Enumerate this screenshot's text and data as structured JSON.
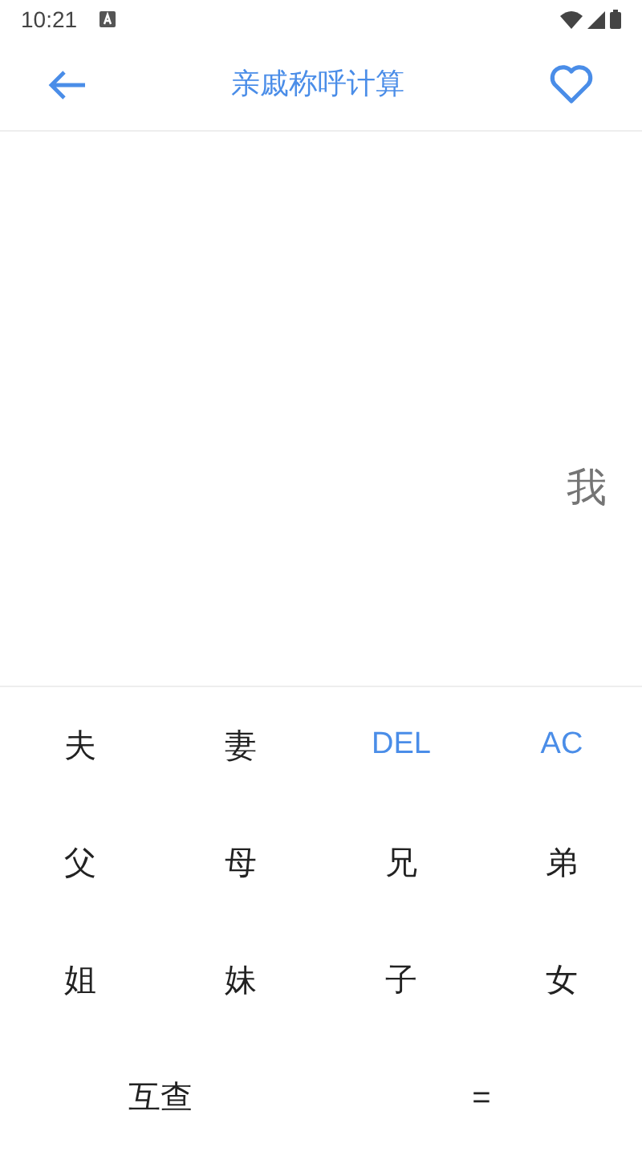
{
  "status_bar": {
    "time": "10:21"
  },
  "header": {
    "title": "亲戚称呼计算"
  },
  "display": {
    "text": "我"
  },
  "keypad": [
    {
      "label": "夫",
      "kind": "char"
    },
    {
      "label": "妻",
      "kind": "char"
    },
    {
      "label": "DEL",
      "kind": "action"
    },
    {
      "label": "AC",
      "kind": "action"
    },
    {
      "label": "父",
      "kind": "char"
    },
    {
      "label": "母",
      "kind": "char"
    },
    {
      "label": "兄",
      "kind": "char"
    },
    {
      "label": "弟",
      "kind": "char"
    },
    {
      "label": "姐",
      "kind": "char"
    },
    {
      "label": "妹",
      "kind": "char"
    },
    {
      "label": "子",
      "kind": "char"
    },
    {
      "label": "女",
      "kind": "char"
    },
    {
      "label": "互查",
      "kind": "wide"
    },
    {
      "label": "=",
      "kind": "wide"
    }
  ]
}
